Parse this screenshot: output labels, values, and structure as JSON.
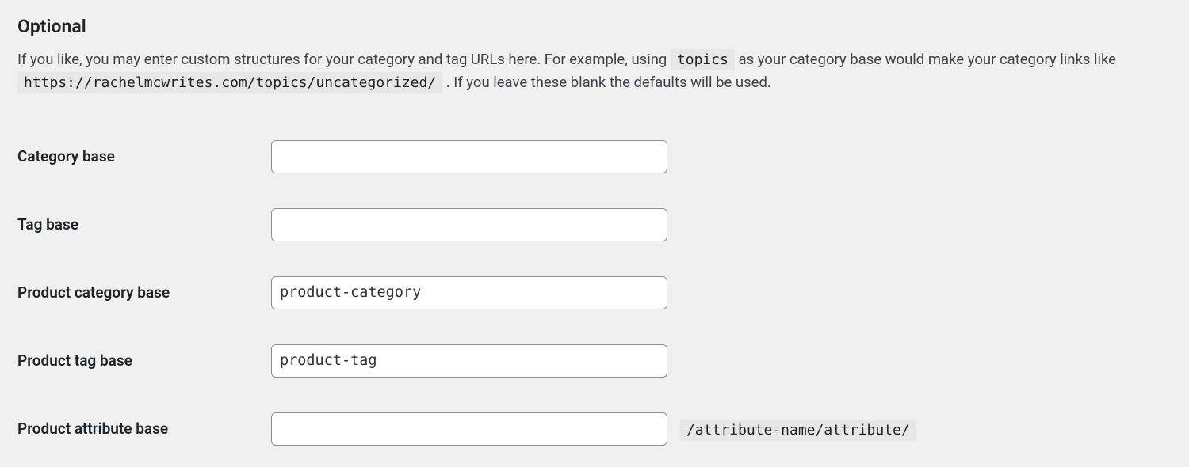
{
  "heading": "Optional",
  "description": {
    "before_code1": "If you like, you may enter custom structures for your category and tag URLs here. For example, using ",
    "code1": "topics",
    "between": " as your category base would make your category links like ",
    "code2": "https://rachelmcwrites.com/topics/uncategorized/",
    "after": " . If you leave these blank the defaults will be used."
  },
  "fields": {
    "category_base": {
      "label": "Category base",
      "value": ""
    },
    "tag_base": {
      "label": "Tag base",
      "value": ""
    },
    "product_category_base": {
      "label": "Product category base",
      "value": "product-category"
    },
    "product_tag_base": {
      "label": "Product tag base",
      "value": "product-tag"
    },
    "product_attribute_base": {
      "label": "Product attribute base",
      "value": "",
      "suffix": "/attribute-name/attribute/"
    }
  }
}
